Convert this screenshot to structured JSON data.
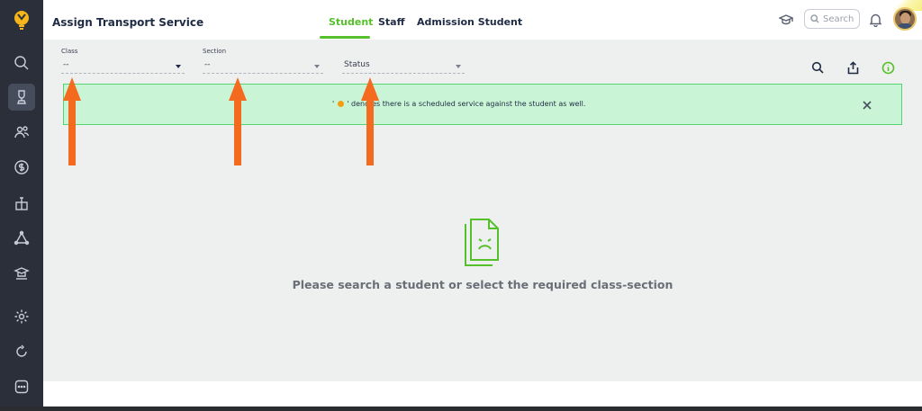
{
  "header": {
    "title": "Assign Transport Service",
    "tabs": [
      {
        "label": "Student",
        "active": true
      },
      {
        "label": "Staff",
        "active": false
      },
      {
        "label": "Admission Student",
        "active": false
      }
    ],
    "search_placeholder": "Search",
    "icons": [
      "graduation-cap-icon",
      "search-icon",
      "bell-icon",
      "avatar"
    ]
  },
  "sidebar": {
    "items": [
      {
        "name": "search-icon"
      },
      {
        "name": "trophy-icon",
        "active": true
      },
      {
        "name": "users-icon"
      },
      {
        "name": "dollar-icon"
      },
      {
        "name": "gift-icon"
      },
      {
        "name": "triangle-nodes-icon"
      },
      {
        "name": "school-icon"
      },
      {
        "name": "settings-icon"
      },
      {
        "name": "refresh-icon"
      },
      {
        "name": "more-icon"
      }
    ]
  },
  "filters": {
    "class": {
      "label": "Class",
      "value": "--"
    },
    "section": {
      "label": "Section",
      "value": "--"
    },
    "status": {
      "label": "",
      "value": "Status"
    }
  },
  "toolbar": {
    "icons": [
      "search-icon",
      "share-icon",
      "info-icon"
    ]
  },
  "notice": {
    "text_before": "' ",
    "text_after": " ' denotes there is a scheduled service against the student as well.",
    "dot_color": "#f39c12"
  },
  "empty_state": {
    "message": "Please search a student or select the required class-section"
  },
  "colors": {
    "accent": "#56c02b",
    "sidebar_bg": "#2b2f3a",
    "notice_bg": "#c9f5d6",
    "arrow": "#f46a1e"
  }
}
